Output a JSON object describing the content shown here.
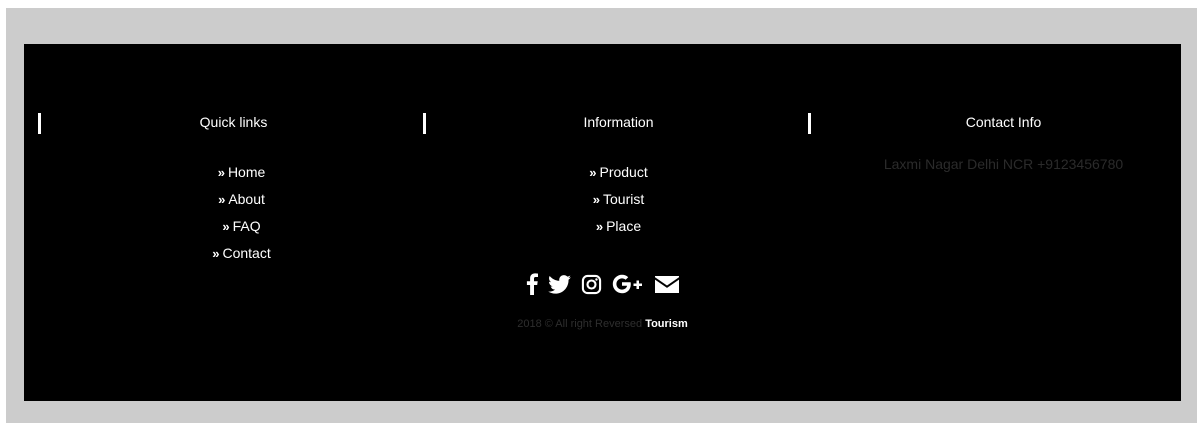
{
  "columns": {
    "quick_links": {
      "title": "Quick links",
      "items": [
        "Home",
        "About",
        "FAQ",
        "Contact"
      ]
    },
    "information": {
      "title": "Information",
      "items": [
        "Product",
        "Tourist",
        "Place"
      ]
    },
    "contact_info": {
      "title": "Contact Info",
      "text": "Laxmi Nagar Delhi NCR +9123456780"
    }
  },
  "link_bullet": "»",
  "social_icons": [
    "facebook-icon",
    "twitter-icon",
    "instagram-icon",
    "google-plus-icon",
    "mail-icon"
  ],
  "copyright": {
    "text": "2018 © All right Reversed",
    "brand": "Tourism"
  },
  "colors": {
    "outer_frame": "#cccccc",
    "footer_bg": "#000000",
    "text": "#ffffff",
    "muted_text": "#2b2b2b",
    "copyright_text": "#2e2e2e"
  }
}
